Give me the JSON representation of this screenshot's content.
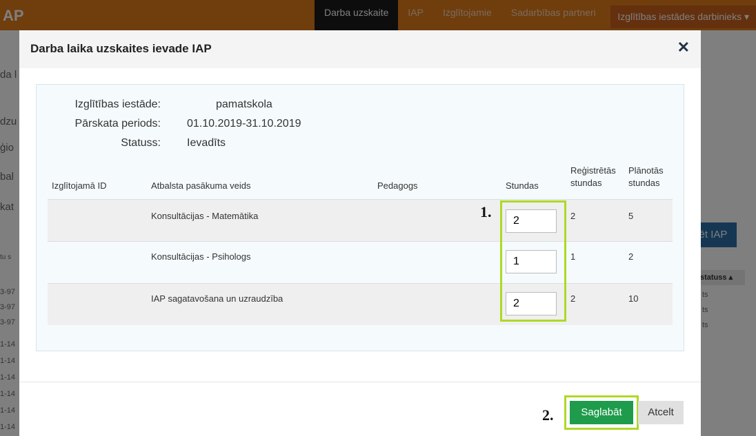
{
  "app": {
    "logo": "AP",
    "nav": [
      "Darba uzskaite",
      "IAP",
      "Izglītojamie",
      "Sadarbības partneri"
    ],
    "user_menu": "Izglītības iestādes darbinieks ▾",
    "bg_fragments": [
      "da l",
      "dzu",
      "ģio",
      "bal",
      "kat",
      "tu s"
    ],
    "bg_button": "ēt IAP",
    "bg_column": "statuss ▴",
    "bg_rows": [
      "3-97",
      "3-97",
      "3-97",
      "1-14",
      "1-14",
      "1-14",
      "1-14",
      "1-14",
      "1-14"
    ],
    "bg_status": [
      "ts",
      "ts",
      "ts"
    ]
  },
  "modal": {
    "title": "Darba laika uzskaites ievade IAP",
    "close_icon": "close-icon",
    "info": [
      {
        "label": "Izglītības iestāde:",
        "value": "pamatskola"
      },
      {
        "label": "Pārskata periods:",
        "value": "01.10.2019-31.10.2019"
      },
      {
        "label": "Statuss:",
        "value": "Ievadīts"
      }
    ],
    "table": {
      "headers": {
        "student_id": "Izglītojamā ID",
        "support_type": "Atbalsta pasākuma veids",
        "teacher": "Pedagogs",
        "hours": "Stundas",
        "registered": "Reģistrētās stundas",
        "planned": "Plānotās stundas"
      },
      "rows": [
        {
          "student_id": "",
          "support_type": "Konsultācijas - Matemātika",
          "teacher": "",
          "hours": "2",
          "registered": "2",
          "planned": "5"
        },
        {
          "student_id": "",
          "support_type": "Konsultācijas - Psihologs",
          "teacher": "",
          "hours": "1",
          "registered": "1",
          "planned": "2"
        },
        {
          "student_id": "",
          "support_type": "IAP sagatavošana un uzraudzība",
          "teacher": "",
          "hours": "2",
          "registered": "2",
          "planned": "10"
        }
      ]
    },
    "annotations": {
      "step1": "1.",
      "step2": "2."
    },
    "buttons": {
      "save": "Saglabāt",
      "cancel": "Atcelt"
    },
    "colors": {
      "highlight": "#aed926",
      "save": "#1e9c4b",
      "topbar": "#e07a1a"
    }
  }
}
